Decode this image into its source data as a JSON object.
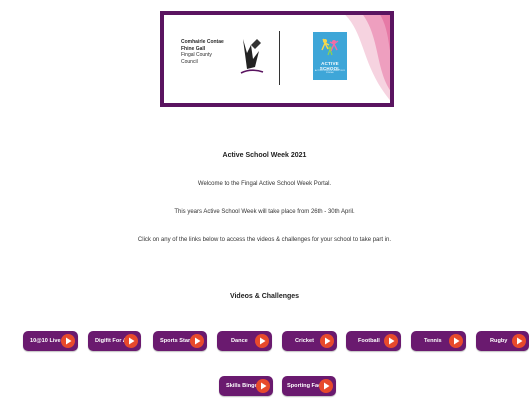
{
  "banner": {
    "council_lines": [
      "Comhairle Contae",
      "Fhine Gall",
      "Fingal County",
      "Council"
    ],
    "logo_text": "ACTIVE SCHOOL",
    "logo_subtext": "ACTIVE SCHOOL WEEK 2021 FINGAL",
    "colors": {
      "frame": "#5a1460",
      "logo_bg": "#3ea6d8",
      "wave": "#f2c4d6"
    }
  },
  "content": {
    "title": "Active School Week 2021",
    "welcome": "Welcome to the Fingal Active School Week Portal.",
    "dates": "This years Active School Week will take place from 26th - 30th April.",
    "instructions": "Click on any of the links below to access the videos & challenges for your school to take part in.",
    "section_heading": "Videos & Challenges"
  },
  "buttons": [
    {
      "label": "10@10 Live"
    },
    {
      "label": "Digifit For All"
    },
    {
      "label": "Sports Stars"
    },
    {
      "label": "Dance"
    },
    {
      "label": "Cricket"
    },
    {
      "label": "Football"
    },
    {
      "label": "Tennis"
    },
    {
      "label": "Rugby"
    },
    {
      "label": "Skills Bingo"
    },
    {
      "label": "Sporting Facts"
    }
  ],
  "colors": {
    "button_bg": "#6a1a6f",
    "arrow_bg": "#e74a2c",
    "arrow_icon": "#ffffff"
  },
  "icons": {
    "button_arrow": "play-arrow-icon"
  }
}
